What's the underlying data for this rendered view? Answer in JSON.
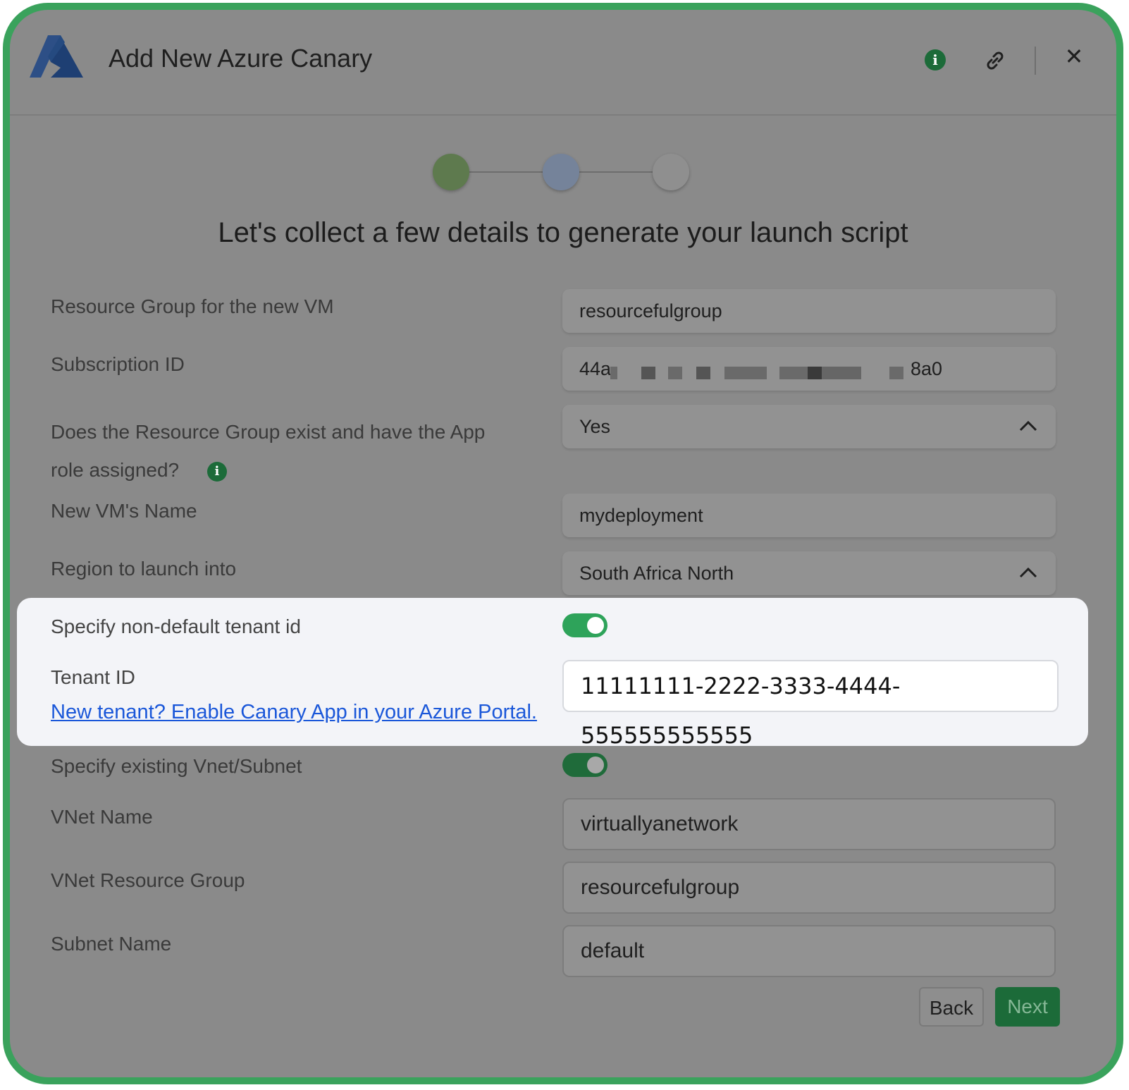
{
  "colors": {
    "frame_border": "#3aa25c",
    "accent_green": "#1c6b39",
    "toggle_on": "#2ea35a",
    "link_blue": "#1a57d9",
    "overlay_gray": "#8a8a8a",
    "highlight_bg": "#f3f4f8"
  },
  "header": {
    "title": "Add New Azure Canary",
    "logo_icon": "azure-logo",
    "info_icon_glyph": "i",
    "close_glyph": "✕"
  },
  "stepper": {
    "steps": [
      {
        "color": "#5e7a4e"
      },
      {
        "color": "#75839a"
      },
      {
        "color": "#8f8f8f"
      }
    ]
  },
  "headline": "Let's collect a few details to generate your launch script",
  "form": {
    "resource_group": {
      "label": "Resource Group for the new VM",
      "value": "resourcefulgroup"
    },
    "subscription": {
      "label": "Subscription ID",
      "value_start": "44a",
      "value_end": "8a0"
    },
    "rg_exists": {
      "label_line1": "Does the Resource Group exist and have the App",
      "label_line2": "role assigned?",
      "info_glyph": "i",
      "value": "Yes"
    },
    "vm_name": {
      "label": "New VM's Name",
      "value": "mydeployment"
    },
    "region": {
      "label": "Region to launch into",
      "value": "South Africa North"
    },
    "tenant_toggle": {
      "label": "Specify non-default tenant id"
    },
    "tenant_id": {
      "label": "Tenant ID",
      "value": "11111111-2222-3333-4444-555555555555",
      "link": "New tenant? Enable Canary App in your Azure Portal."
    },
    "vnet_toggle": {
      "label": "Specify existing Vnet/Subnet"
    },
    "vnet_name": {
      "label": "VNet Name",
      "value": "virtuallyanetwork"
    },
    "vnet_rg": {
      "label": "VNet Resource Group",
      "value": "resourcefulgroup"
    },
    "subnet": {
      "label": "Subnet Name",
      "value": "default"
    }
  },
  "buttons": {
    "back": "Back",
    "next": "Next"
  }
}
